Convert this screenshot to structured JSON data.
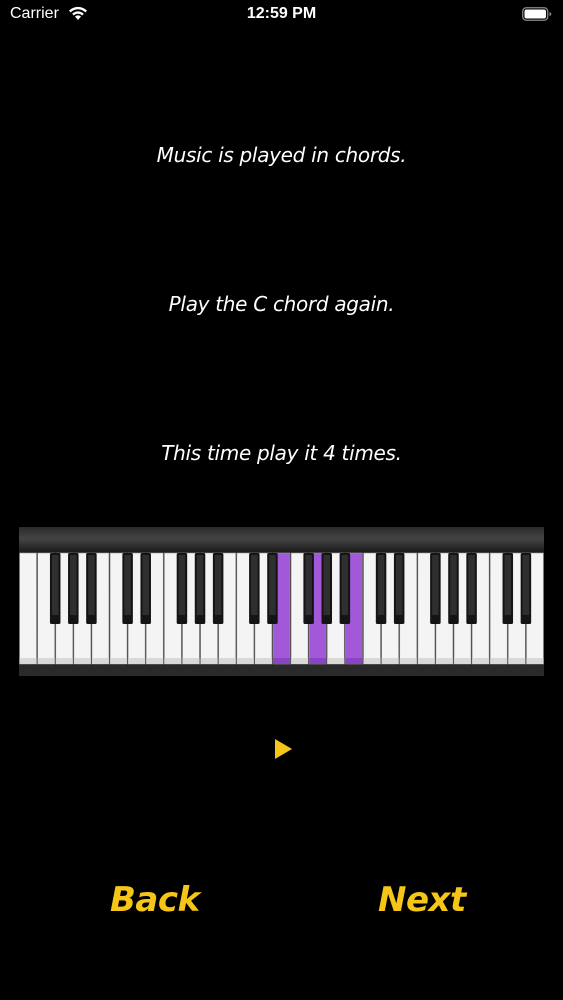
{
  "status_bar": {
    "carrier": "Carrier",
    "time": "12:59 PM",
    "icons": [
      "wifi-icon",
      "battery-icon"
    ]
  },
  "instructions": {
    "line_1": "Music is played in chords.",
    "line_2": "Play the C chord again.",
    "line_3": "This time play it 4 times."
  },
  "keyboard": {
    "highlight_color": "#a259d9",
    "highlighted_keys": [
      "C",
      "E",
      "G"
    ]
  },
  "controls": {
    "play_icon": "play-icon",
    "play_color": "#f5c518",
    "back_label": "Back",
    "next_label": "Next",
    "accent_color": "#f5c518"
  }
}
